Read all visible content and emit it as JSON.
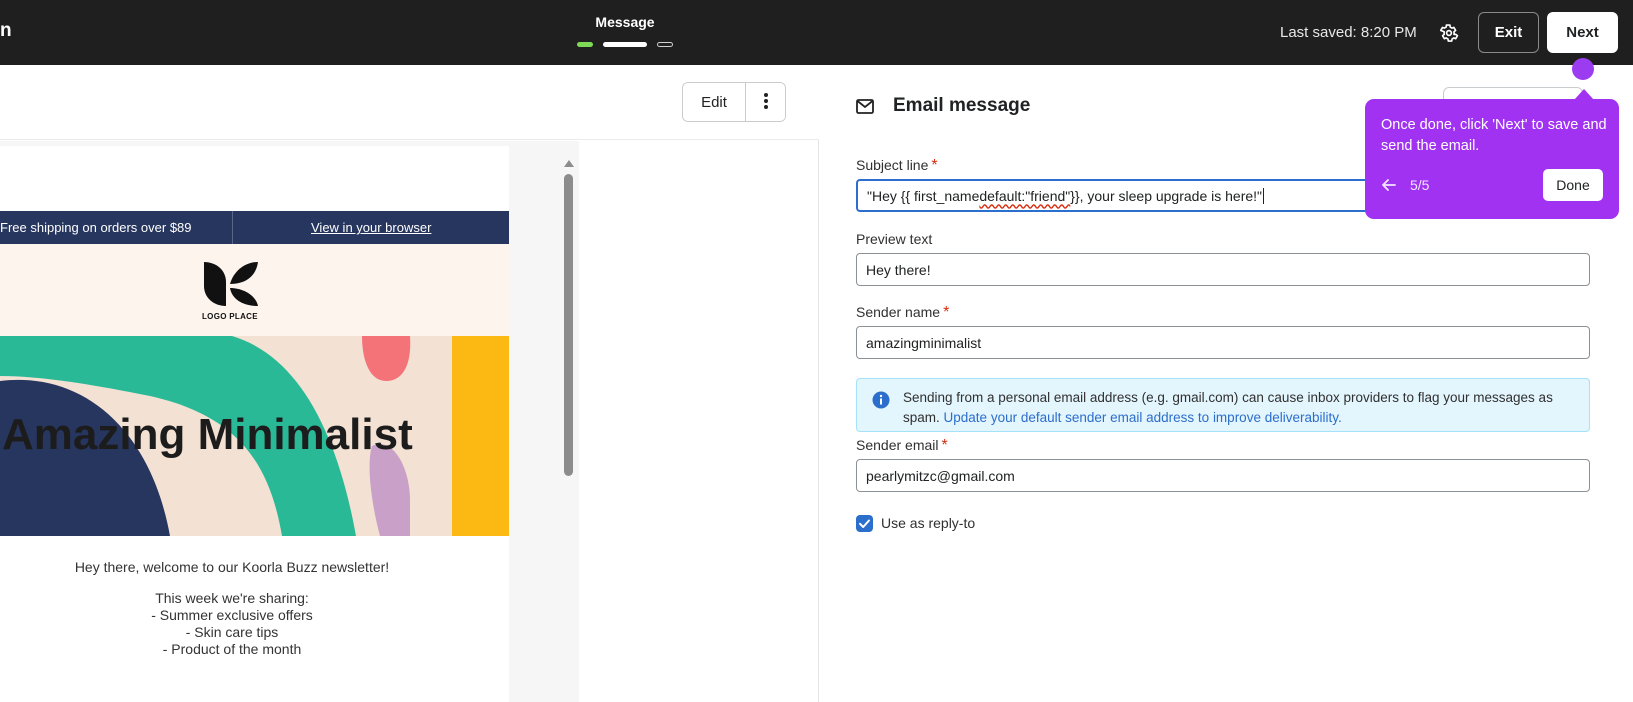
{
  "topbar": {
    "app_title": "n",
    "step_label": "Message",
    "last_saved": "Last saved: 8:20 PM",
    "exit_label": "Exit",
    "next_label": "Next",
    "gear_icon": "gear-icon"
  },
  "preview_toolbar": {
    "edit_label": "Edit",
    "more_icon": "more-vertical-icon"
  },
  "email_preview": {
    "shipping_text": "Free shipping on orders over $89",
    "view_browser": "View in your browser",
    "logo_text": "LOGO PLACE",
    "hero_title": "Amazing Minimalist",
    "welcome": "Hey there, welcome to our Koorla Buzz newsletter!",
    "sharing_intro": "This week we're sharing:",
    "items": [
      "- Summer exclusive offers",
      "- Skin care tips",
      "- Product of the month"
    ],
    "colors": {
      "header_bg": "#27365f",
      "logo_bg": "#fdf4ee",
      "hero_bg": "#f3e1d4",
      "navy": "#27365f",
      "teal": "#2ab996",
      "coral": "#f47378",
      "lilac": "#c9a0c8",
      "yellow": "#fdb913"
    }
  },
  "panel": {
    "title": "Email message",
    "mail_icon": "mail-icon",
    "subject": {
      "label": "Subject line",
      "required": "*",
      "value_part1": "\"Hey {{ first_name",
      "value_part2": "default:\"friend\"",
      "value_part3": " }}, your sleep upgrade is here!\""
    },
    "preview": {
      "label": "Preview text",
      "value": "Hey there!"
    },
    "sender_name": {
      "label": "Sender name",
      "required": "*",
      "value": "amazingminimalist"
    },
    "info": {
      "text": "Sending from a personal email address (e.g. gmail.com) can cause inbox providers to flag your messages as spam.",
      "link": "Update your default sender email address to improve deliverability."
    },
    "sender_email": {
      "label": "Sender email",
      "required": "*",
      "value": "pearlymitzc@gmail.com"
    },
    "reply_to": {
      "label": "Use as reply-to",
      "checked": true
    }
  },
  "tour": {
    "text": "Once done, click 'Next' to save and send the email.",
    "count": "5/5",
    "done_label": "Done",
    "color": "#a132f2"
  }
}
